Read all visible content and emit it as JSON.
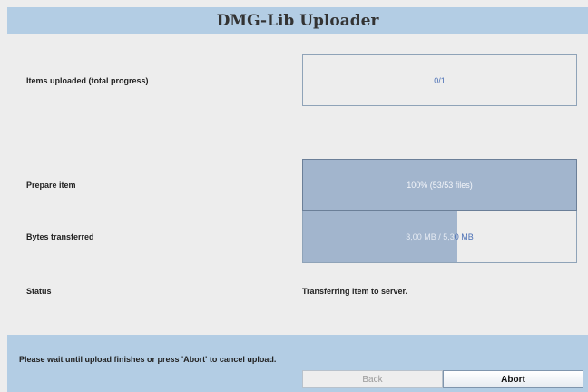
{
  "header": {
    "title": "DMG-Lib Uploader"
  },
  "rows": {
    "total": {
      "label": "Items uploaded (total progress)",
      "value_text": "0/1",
      "progress": 0.0
    },
    "prepare": {
      "label": "Prepare item",
      "value_text": "100% (53/53 files)",
      "progress": 1.0
    },
    "bytes": {
      "label": "Bytes transferred",
      "value_text_a": "3,00 MB / 5,3",
      "value_text_b": "0 MB",
      "progress": 0.566
    },
    "status": {
      "label": "Status",
      "value": "Transferring item to server."
    }
  },
  "footer": {
    "message": "Please wait until upload finishes or press 'Abort' to cancel upload.",
    "back_label": "Back",
    "abort_label": "Abort"
  },
  "colors": {
    "accent": "#b3cde4",
    "progress_fill": "#a2b5cd",
    "link_text": "#4a6fb5"
  }
}
